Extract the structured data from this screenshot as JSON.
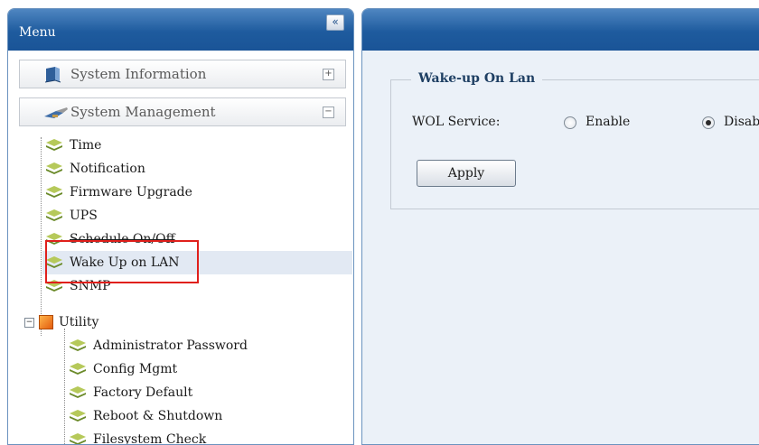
{
  "menu": {
    "title": "Menu",
    "collapse_glyph": "«",
    "sections": [
      {
        "label": "System Information",
        "icon": "book-icon",
        "toggle": "+"
      },
      {
        "label": "System Management",
        "icon": "tools-icon",
        "toggle": "−"
      }
    ],
    "items": [
      {
        "label": "Time"
      },
      {
        "label": "Notification"
      },
      {
        "label": "Firmware Upgrade"
      },
      {
        "label": "UPS"
      },
      {
        "label": "Schedule On/Off"
      },
      {
        "label": "Wake Up on LAN"
      },
      {
        "label": "SNMP"
      }
    ],
    "utility": {
      "label": "Utility",
      "toggle": "−",
      "items": [
        {
          "label": "Administrator Password"
        },
        {
          "label": "Config Mgmt"
        },
        {
          "label": "Factory Default"
        },
        {
          "label": "Reboot & Shutdown"
        },
        {
          "label": "Filesystem Check"
        }
      ]
    }
  },
  "content": {
    "legend": "Wake-up On Lan",
    "wol_label": "WOL Service:",
    "option_enable": "Enable",
    "option_disable": "Disable",
    "selected_option": "Disable",
    "apply_label": "Apply"
  },
  "colors": {
    "header_blue": "#1e5b9e",
    "content_bg": "#ebf1f8",
    "highlight_red": "#e0201c"
  }
}
